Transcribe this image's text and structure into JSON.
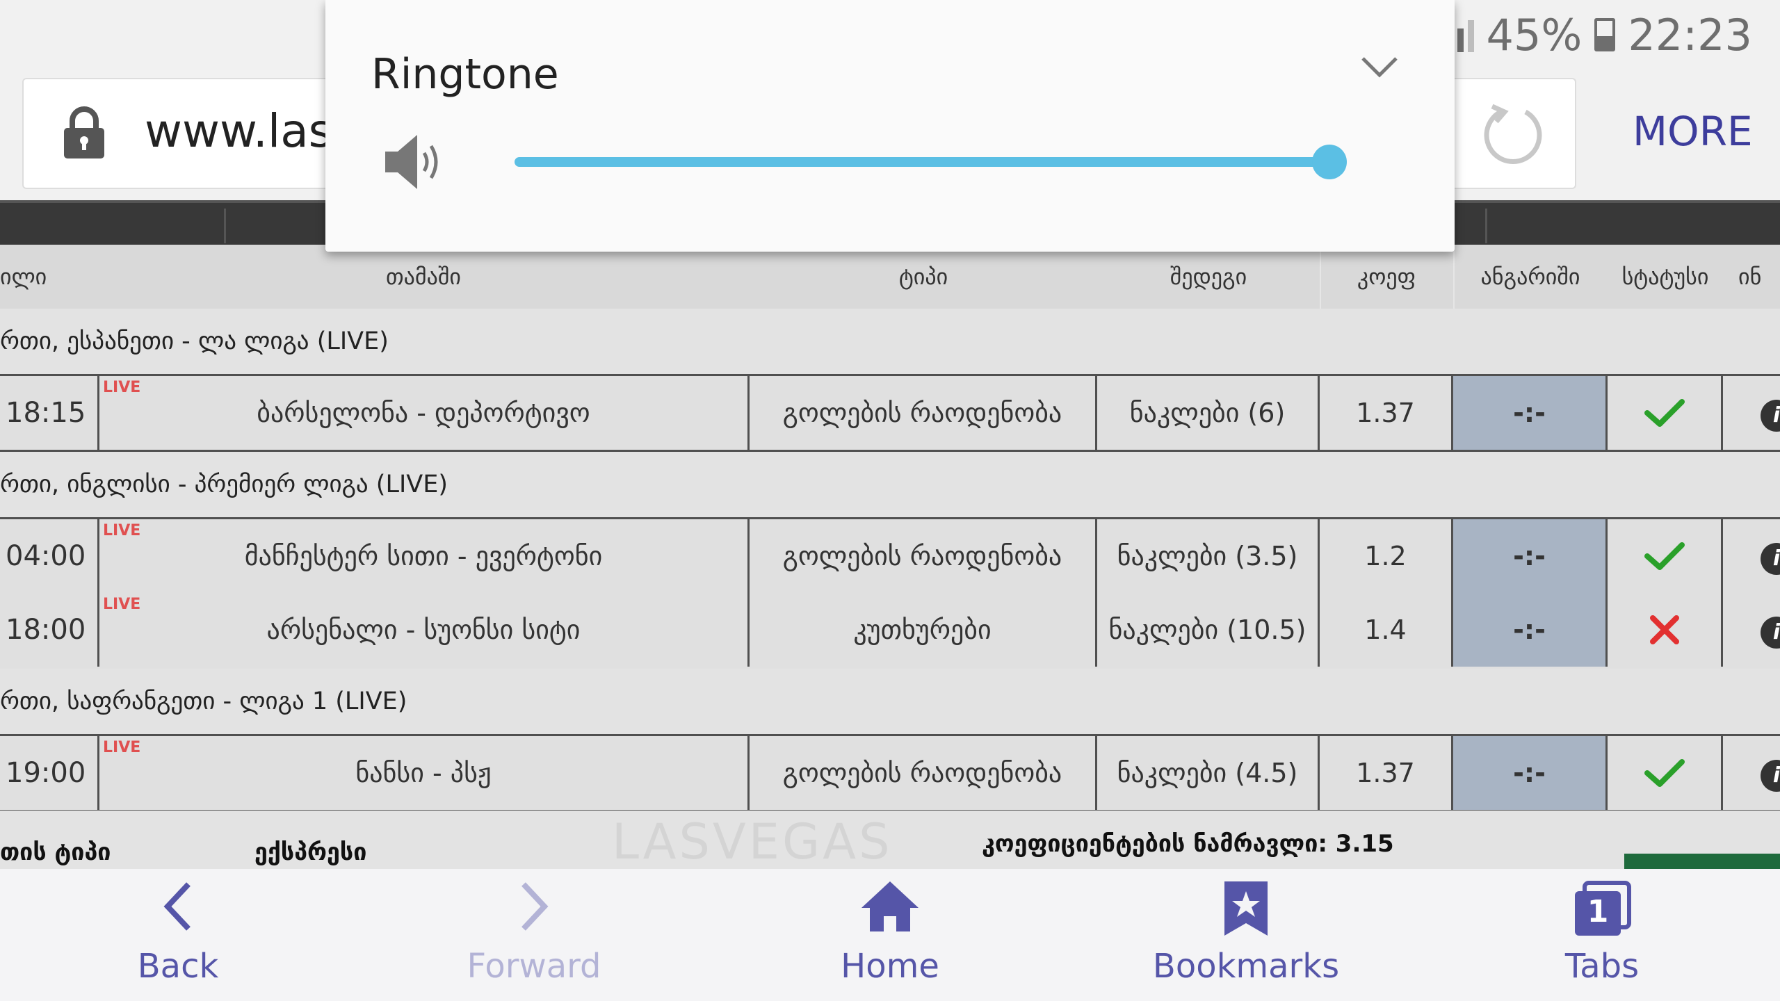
{
  "status_bar": {
    "battery_text": "45%",
    "time": "22:23"
  },
  "browser": {
    "url_text": "www.las",
    "more_label": "MORE"
  },
  "table": {
    "columns": {
      "col0": "ილი",
      "game": "თამაში",
      "type": "ტიპი",
      "result": "შედეგი",
      "odds": "კოეფ",
      "score": "ანგარიში",
      "status": "სტატუსი",
      "info": "ინ"
    },
    "groups": [
      {
        "label": "რთი, ესპანეთი - ლა ლიგა (LIVE)"
      },
      {
        "label": "რთი, ინგლისი - პრემიერ ლიგა (LIVE)"
      },
      {
        "label": "რთი, საფრანგეთი - ლიგა 1 (LIVE)"
      }
    ],
    "rows": [
      {
        "time": "18:15",
        "live": "LIVE",
        "game": "ბარსელონა - დეპორტივო",
        "type": "გოლების რაოდენობა",
        "result": "ნაკლები (6)",
        "odds": "1.37",
        "score": "-:-",
        "status": "won",
        "info": "i"
      },
      {
        "time": "04:00",
        "live": "LIVE",
        "game": "მანჩესტერ სითი - ევერტონი",
        "type": "გოლების რაოდენობა",
        "result": "ნაკლები (3.5)",
        "odds": "1.2",
        "score": "-:-",
        "status": "won",
        "info": "i"
      },
      {
        "time": "18:00",
        "live": "LIVE",
        "game": "არსენალი - სუონსი სიტი",
        "type": "კუთხურები",
        "result": "ნაკლები (10.5)",
        "odds": "1.4",
        "score": "-:-",
        "status": "lost",
        "info": "i"
      },
      {
        "time": "19:00",
        "live": "LIVE",
        "game": "ნანსი - პსჟ",
        "type": "გოლების რაოდენობა",
        "result": "ნაკლები (4.5)",
        "odds": "1.37",
        "score": "-:-",
        "status": "won",
        "info": "i"
      }
    ],
    "footer": {
      "type_label": "თის ტიპი",
      "type_value": "ექსპრესი",
      "product_label": "კოეფიციენტების ნამრავლი: 3.15"
    }
  },
  "watermark_text": "LASVEGAS",
  "bottom_nav": {
    "back": "Back",
    "forward": "Forward",
    "home": "Home",
    "bookmarks": "Bookmarks",
    "tabs": "Tabs",
    "tabs_count": "1"
  },
  "volume_popup": {
    "title": "Ringtone",
    "level": 1.0,
    "accent_color": "#5bbfe4"
  },
  "colors": {
    "nav_accent": "#5555a8",
    "won": "#2aa02a",
    "lost": "#e23030",
    "live": "#e05050"
  }
}
